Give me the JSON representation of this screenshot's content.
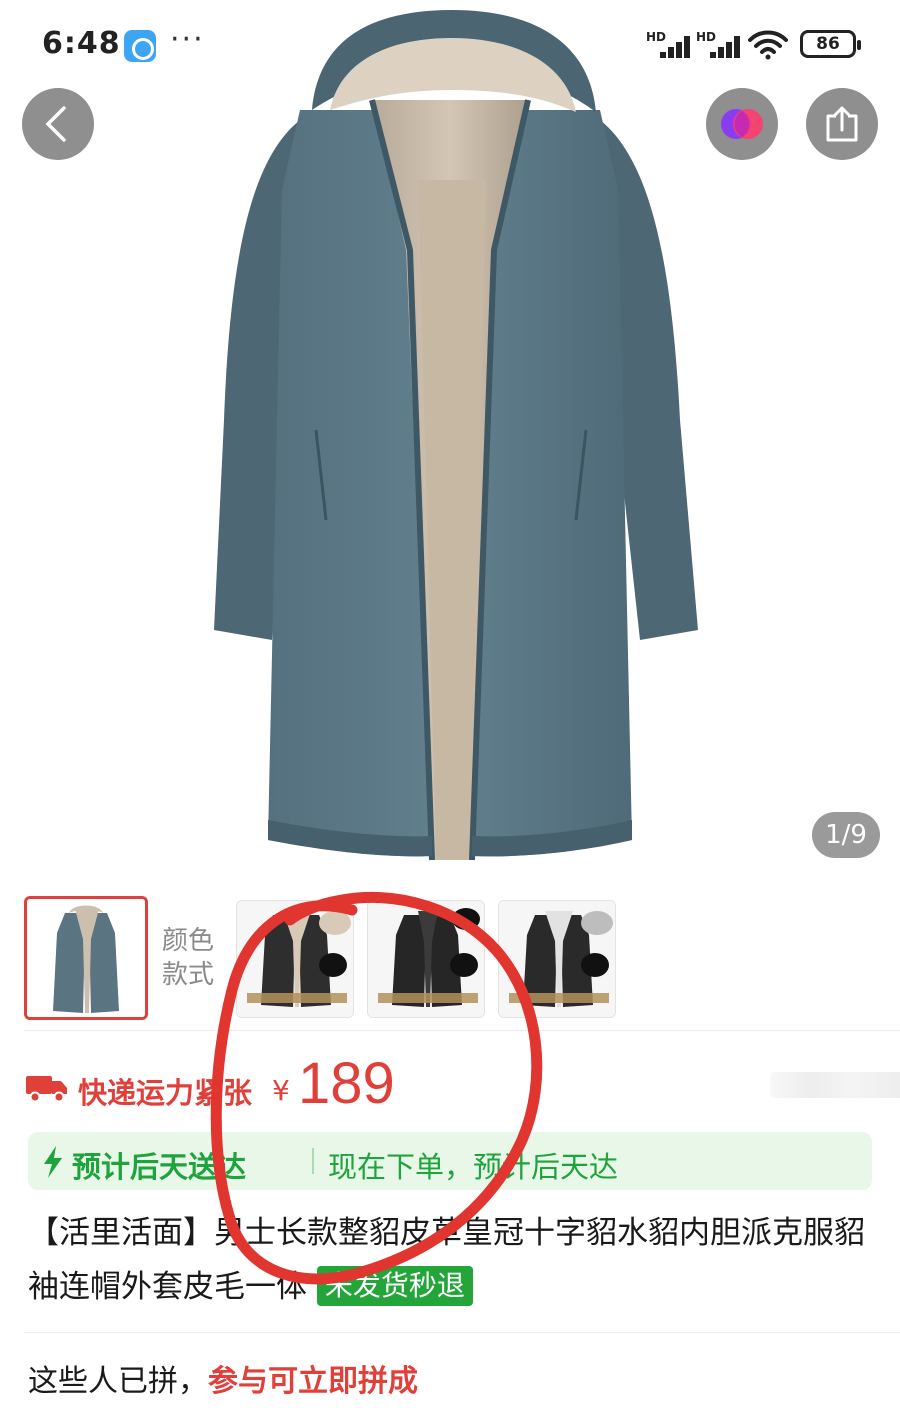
{
  "status_bar": {
    "time": "6:48",
    "more": "···",
    "signal_1_label": "HD",
    "signal_2_label": "HD",
    "battery": "86"
  },
  "gallery": {
    "page_indicator": "1/9",
    "icons": {
      "back": "chevron-left-icon",
      "merge": "overlap-circles-icon",
      "share": "share-icon"
    }
  },
  "variants": {
    "label_line1": "颜色",
    "label_line2": "款式",
    "selected_index": 0
  },
  "price": {
    "shortage_text": "快递运力紧张",
    "currency": "¥",
    "value": "189"
  },
  "delivery": {
    "headline": "预计后天送达",
    "detail": "现在下单，预计后天达"
  },
  "product": {
    "title": "【活里活面】男士长款整貂皮草皇冠十字貂水貂内胆派克服貂袖连帽外套皮毛一体",
    "badge": "未发货秒退"
  },
  "group_buy": {
    "prefix": "这些人已拼，",
    "accent": "参与可立即拼成"
  },
  "colors": {
    "accent_red": "#e0403a",
    "delivery_green": "#1ea43c",
    "badge_green": "#23a53a",
    "coat_shell": "#5a7482",
    "coat_lining": "#cdbfae"
  }
}
